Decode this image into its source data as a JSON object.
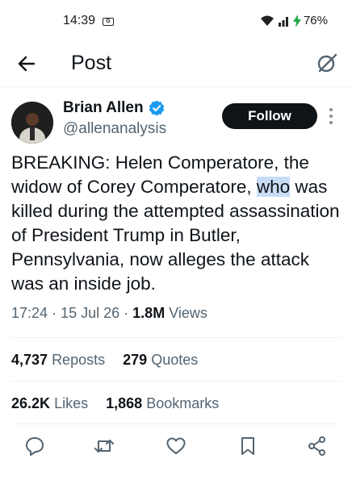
{
  "status_bar": {
    "time": "14:39",
    "sim_label": "G",
    "battery": "76%"
  },
  "header": {
    "title": "Post"
  },
  "author": {
    "name": "Brian Allen",
    "handle": "@allenanalysis",
    "follow_label": "Follow"
  },
  "tweet": {
    "text_pre": "BREAKING: Helen Comperatore, the widow of Corey Comperatore, ",
    "text_highlight": "who",
    "text_post": " was killed during the attempted assassination of President Trump in Butler, Pennsylvania, now alleges the attack was an inside job."
  },
  "meta": {
    "time": "17:24",
    "sep1": "·",
    "date": "15 Jul 26",
    "sep2": "·",
    "views_count": "1.8M",
    "views_label": "Views"
  },
  "stats": {
    "reposts_count": "4,737",
    "reposts_label": "Reposts",
    "quotes_count": "279",
    "quotes_label": "Quotes",
    "likes_count": "26.2K",
    "likes_label": "Likes",
    "bookmarks_count": "1,868",
    "bookmarks_label": "Bookmarks"
  },
  "icons": {
    "back": "arrow-left-icon",
    "grok": "grok-icon",
    "verified": "verified-badge-icon",
    "more": "more-vertical-icon",
    "reply": "reply-icon",
    "repost": "repost-icon",
    "like": "heart-icon",
    "bookmark": "bookmark-icon",
    "share": "share-icon"
  },
  "colors": {
    "text": "#0f1419",
    "secondary": "#536471",
    "verified": "#1d9bf0",
    "highlight": "#c9dcf5",
    "button": "#0f1419"
  }
}
